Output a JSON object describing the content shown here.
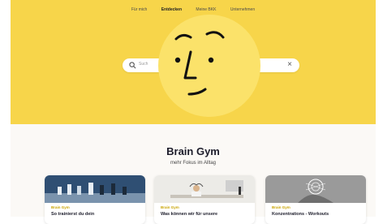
{
  "nav": {
    "items": [
      "Für mich",
      "Entdecken",
      "Meine BKK",
      "Unternehmen"
    ],
    "active_index": 1
  },
  "search": {
    "placeholder": "Such"
  },
  "hero": {
    "background_color": "#f7d54a",
    "mascot_color": "#fbe26a"
  },
  "content": {
    "title": "Brain Gym",
    "subtitle": "mehr Fokus im Alltag",
    "cards": [
      {
        "category": "Brain Gym",
        "title": "So trainierst du dein",
        "image": "chess-pieces"
      },
      {
        "category": "Brain Gym",
        "title": "Was können wir für unsere",
        "image": "person-relaxing-at-desk"
      },
      {
        "category": "Brain Gym",
        "title": "Konzentrations - Workouts",
        "image": "hand-with-glowing-brain"
      }
    ]
  }
}
